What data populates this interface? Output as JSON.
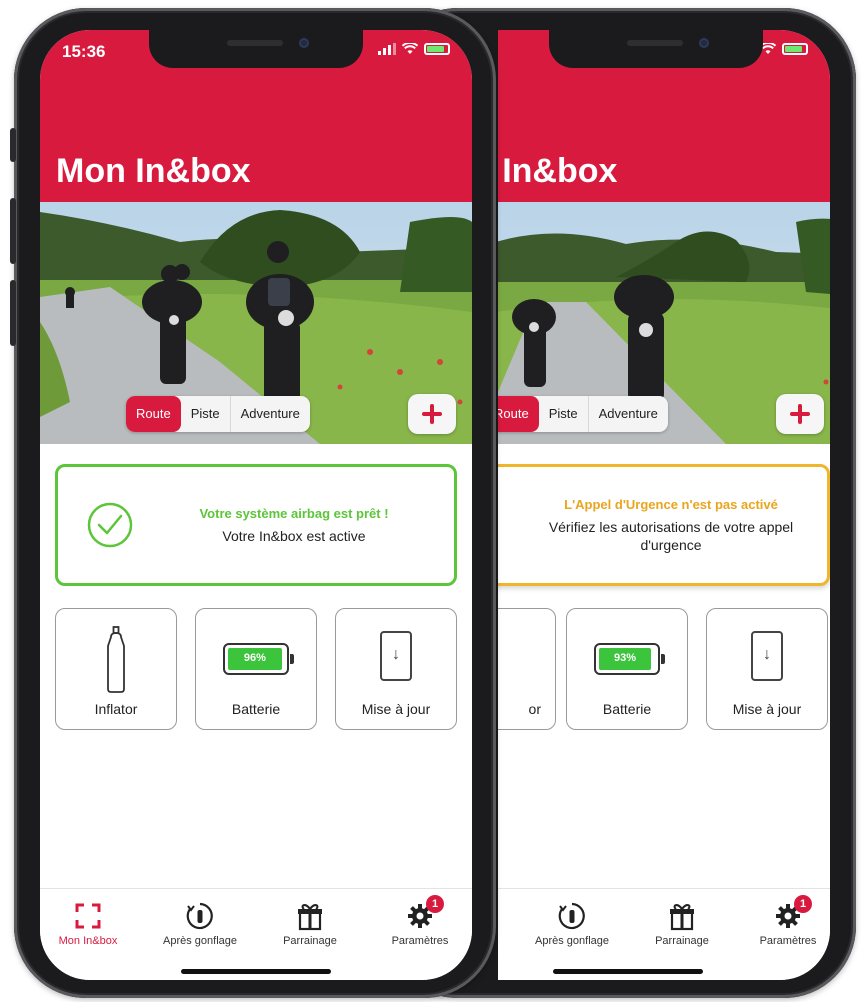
{
  "colors": {
    "brand_red": "#d91a3f",
    "success_green": "#5cc53a",
    "warning_amber": "#efb62c"
  },
  "left_phone": {
    "status_time": "15:36",
    "app_title": "Mon In&box",
    "segments": [
      "Route",
      "Piste",
      "Adventure"
    ],
    "active_segment": "Route",
    "status_card": {
      "title": "Votre système airbag est prêt !",
      "subtitle": "Votre In&box est active"
    },
    "tiles": {
      "inflator_label": "Inflator",
      "battery_label": "Batterie",
      "battery_percent": "96%",
      "battery_level": 96,
      "update_label": "Mise à jour"
    },
    "tabs": [
      "Mon In&box",
      "Après gonflage",
      "Parrainage",
      "Paramètres"
    ],
    "settings_badge": "1"
  },
  "right_phone": {
    "app_title": "n In&box",
    "segments": [
      "Route",
      "Piste",
      "Adventure"
    ],
    "active_segment": "Route",
    "status_card": {
      "title": "L'Appel d'Urgence n'est pas activé",
      "subtitle": "Vérifiez les autorisations de votre appel d'urgence"
    },
    "tiles": {
      "inflator_label_partial": "or",
      "battery_label": "Batterie",
      "battery_percent": "93%",
      "battery_level": 93,
      "update_label": "Mise à jour"
    },
    "tabs": [
      "Après gonflage",
      "Parrainage",
      "Paramètres"
    ],
    "settings_badge": "1"
  }
}
